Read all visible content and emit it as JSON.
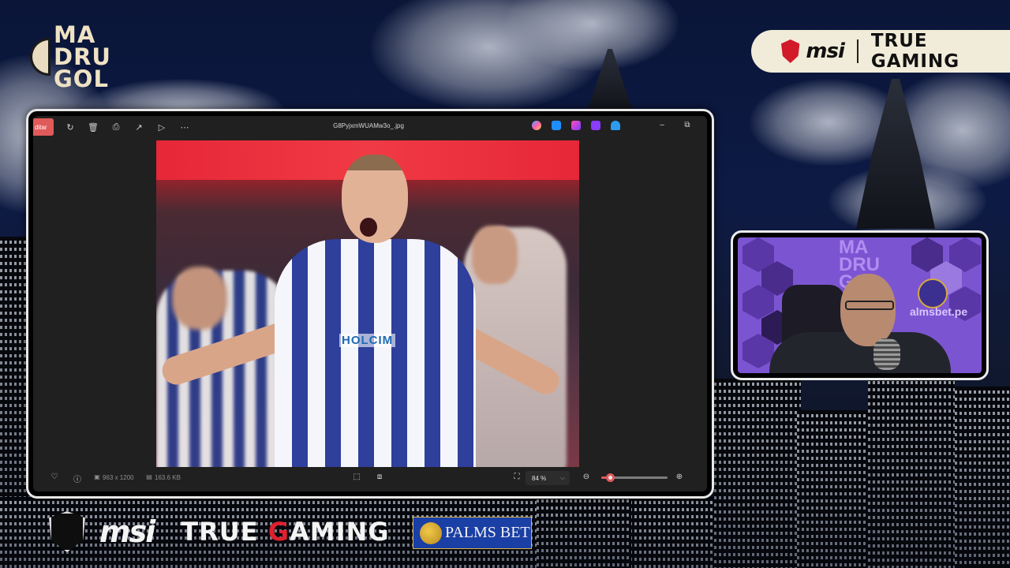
{
  "branding": {
    "logo_text": [
      "MA",
      "DRU",
      "GOL"
    ],
    "msi_banner": {
      "brand": "msi",
      "tagline": "TRUE GAMING"
    },
    "footer_msi": {
      "brand": "msi",
      "tagline_prefix": "TRUE ",
      "tagline_accent": "G",
      "tagline_rest": "AMING"
    },
    "footer_palmsbet": "PALMS BET"
  },
  "viewer": {
    "edit_label": "ditar",
    "filename": "G8PyjxmWUAMw3o_.jpg",
    "toolbar_icons": [
      "rotate-icon",
      "delete-icon",
      "print-icon",
      "share-icon",
      "slideshow-icon",
      "more-icon"
    ],
    "app_icons": [
      "copilot-icon",
      "clipchamp-icon",
      "designer-icon",
      "clipchamp-alt-icon",
      "onedrive-icon"
    ],
    "dimensions": "963 x 1200",
    "file_size": "163.6 KB",
    "zoom": "84 %",
    "zoom_fraction": 0.13,
    "photo": {
      "sponsor_text": "HOLCIM"
    }
  },
  "webcam": {
    "watermark": [
      "MA",
      "DRU",
      "GOL"
    ],
    "sponsor_text": "almsbet.pe"
  },
  "colors": {
    "accent_red": "#e05a5a",
    "msi_red": "#d11a2a",
    "banner_bg": "#f1ecd9",
    "cam_purple": "#7b55d1"
  }
}
